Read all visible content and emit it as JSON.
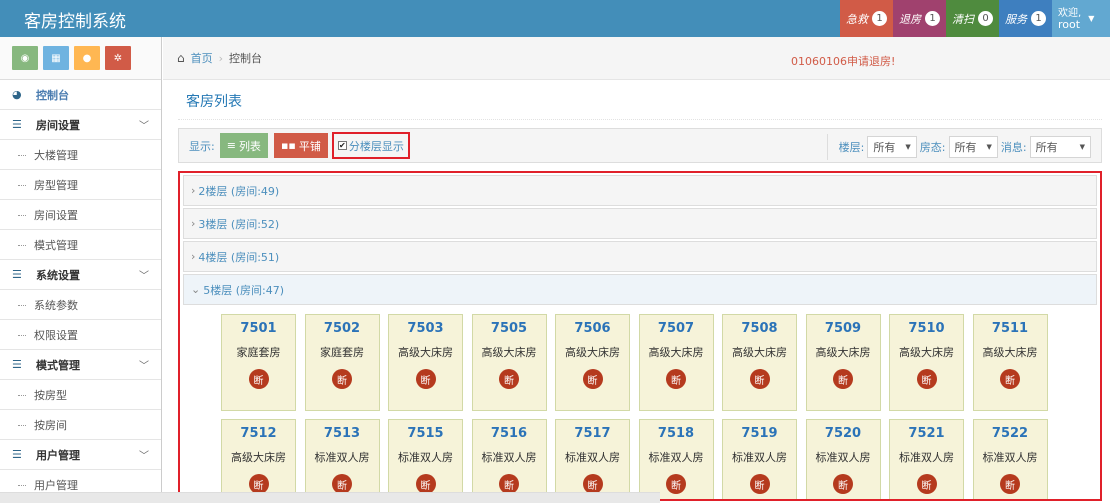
{
  "app": {
    "title": "客房控制系统"
  },
  "topbar": {
    "buttons": [
      {
        "label": "急救",
        "count": "1"
      },
      {
        "label": "退房",
        "count": "1"
      },
      {
        "label": "清扫",
        "count": "0"
      },
      {
        "label": "服务",
        "count": "1"
      }
    ],
    "user": {
      "welcome": "欢迎,",
      "name": "root"
    }
  },
  "sidebar": {
    "shortcut_icons": [
      "dashboard-icon",
      "grid-icon",
      "user-icon",
      "cogs-icon"
    ],
    "items": [
      {
        "label": "控制台",
        "icon": "dashboard-icon",
        "kind": "top"
      },
      {
        "label": "房间设置",
        "icon": "list-icon",
        "kind": "group"
      },
      {
        "label": "大楼管理",
        "kind": "sub"
      },
      {
        "label": "房型管理",
        "kind": "sub"
      },
      {
        "label": "房间设置",
        "kind": "sub"
      },
      {
        "label": "模式管理",
        "kind": "sub"
      },
      {
        "label": "系统设置",
        "icon": "list-icon",
        "kind": "group"
      },
      {
        "label": "系统参数",
        "kind": "sub"
      },
      {
        "label": "权限设置",
        "kind": "sub"
      },
      {
        "label": "模式管理",
        "icon": "list-icon",
        "kind": "group"
      },
      {
        "label": "按房型",
        "kind": "sub"
      },
      {
        "label": "按房间",
        "kind": "sub"
      },
      {
        "label": "用户管理",
        "icon": "list-icon",
        "kind": "group"
      },
      {
        "label": "用户管理",
        "kind": "sub"
      }
    ]
  },
  "breadcrumb": {
    "home": "首页",
    "current": "控制台"
  },
  "alert": "01060106申请退房!",
  "page": {
    "title": "客房列表"
  },
  "toolbar": {
    "display_label": "显示:",
    "list_label": "列表",
    "tile_label": "平铺",
    "floor_toggle_label": "分楼层显示",
    "floor_toggle_checked": "✔",
    "filters": [
      {
        "label": "楼层:",
        "value": "所有"
      },
      {
        "label": "房态:",
        "value": "所有"
      },
      {
        "label": "消息:",
        "value": "所有"
      }
    ]
  },
  "floors": [
    {
      "label": "2楼层 (房间:49)",
      "caret": "›"
    },
    {
      "label": "3楼层 (房间:52)",
      "caret": "›"
    },
    {
      "label": "4楼层 (房间:51)",
      "caret": "›"
    },
    {
      "label": "5楼层 (房间:47)",
      "caret": "⌄"
    }
  ],
  "rooms": [
    {
      "number": "7501",
      "type": "家庭套房",
      "status": "断"
    },
    {
      "number": "7502",
      "type": "家庭套房",
      "status": "断"
    },
    {
      "number": "7503",
      "type": "高级大床房",
      "status": "断"
    },
    {
      "number": "7505",
      "type": "高级大床房",
      "status": "断"
    },
    {
      "number": "7506",
      "type": "高级大床房",
      "status": "断"
    },
    {
      "number": "7507",
      "type": "高级大床房",
      "status": "断"
    },
    {
      "number": "7508",
      "type": "高级大床房",
      "status": "断"
    },
    {
      "number": "7509",
      "type": "高级大床房",
      "status": "断"
    },
    {
      "number": "7510",
      "type": "高级大床房",
      "status": "断"
    },
    {
      "number": "7511",
      "type": "高级大床房",
      "status": "断"
    },
    {
      "number": "7512",
      "type": "高级大床房",
      "status": "断"
    },
    {
      "number": "7513",
      "type": "标准双人房",
      "status": "断"
    },
    {
      "number": "7515",
      "type": "标准双人房",
      "status": "断"
    },
    {
      "number": "7516",
      "type": "标准双人房",
      "status": "断"
    },
    {
      "number": "7517",
      "type": "标准双人房",
      "status": "断"
    },
    {
      "number": "7518",
      "type": "标准双人房",
      "status": "断"
    },
    {
      "number": "7519",
      "type": "标准双人房",
      "status": "断"
    },
    {
      "number": "7520",
      "type": "标准双人房",
      "status": "断"
    },
    {
      "number": "7521",
      "type": "标准双人房",
      "status": "断"
    },
    {
      "number": "7522",
      "type": "标准双人房",
      "status": "断"
    }
  ]
}
